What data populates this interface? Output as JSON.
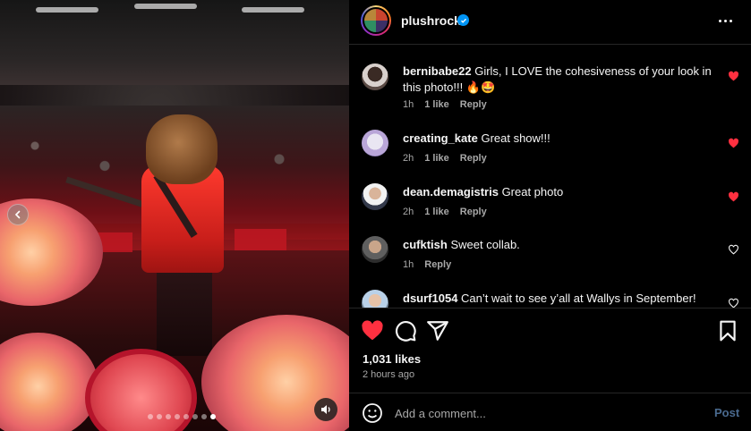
{
  "post": {
    "username": "plushrocks",
    "verified": true,
    "likes": "1,031 likes",
    "time_ago": "2 hours ago",
    "liked": true,
    "carousel": {
      "count": 8,
      "active_index": 7
    }
  },
  "comments": [
    {
      "username": "bernibabe22",
      "text": "Girls, I LOVE the cohesiveness of your look in this photo!!! 🔥🤩",
      "time": "1h",
      "likes": "1 like",
      "reply": "Reply",
      "liked": true
    },
    {
      "username": "creating_kate",
      "text": "Great show!!!",
      "time": "2h",
      "likes": "1 like",
      "reply": "Reply",
      "liked": true
    },
    {
      "username": "dean.demagistris",
      "text": "Great photo",
      "time": "2h",
      "likes": "1 like",
      "reply": "Reply",
      "liked": true
    },
    {
      "username": "cufktish",
      "text": "Sweet collab.",
      "time": "1h",
      "likes": "",
      "reply": "Reply",
      "liked": false
    },
    {
      "username": "dsurf1054",
      "text": "Can’t wait to see y’all at Wallys in September!",
      "time": "",
      "likes": "",
      "reply": "",
      "liked": false
    }
  ],
  "composer": {
    "placeholder": "Add a comment...",
    "post_label": "Post"
  },
  "colors": {
    "heart": "#ff3040",
    "verified": "#0095f6",
    "post_disabled": "#4a6a8f"
  },
  "icons": [
    "heart-icon",
    "comment-icon",
    "share-icon",
    "bookmark-icon",
    "emoji-icon",
    "more-icon",
    "audio-icon",
    "chevron-left-icon"
  ]
}
